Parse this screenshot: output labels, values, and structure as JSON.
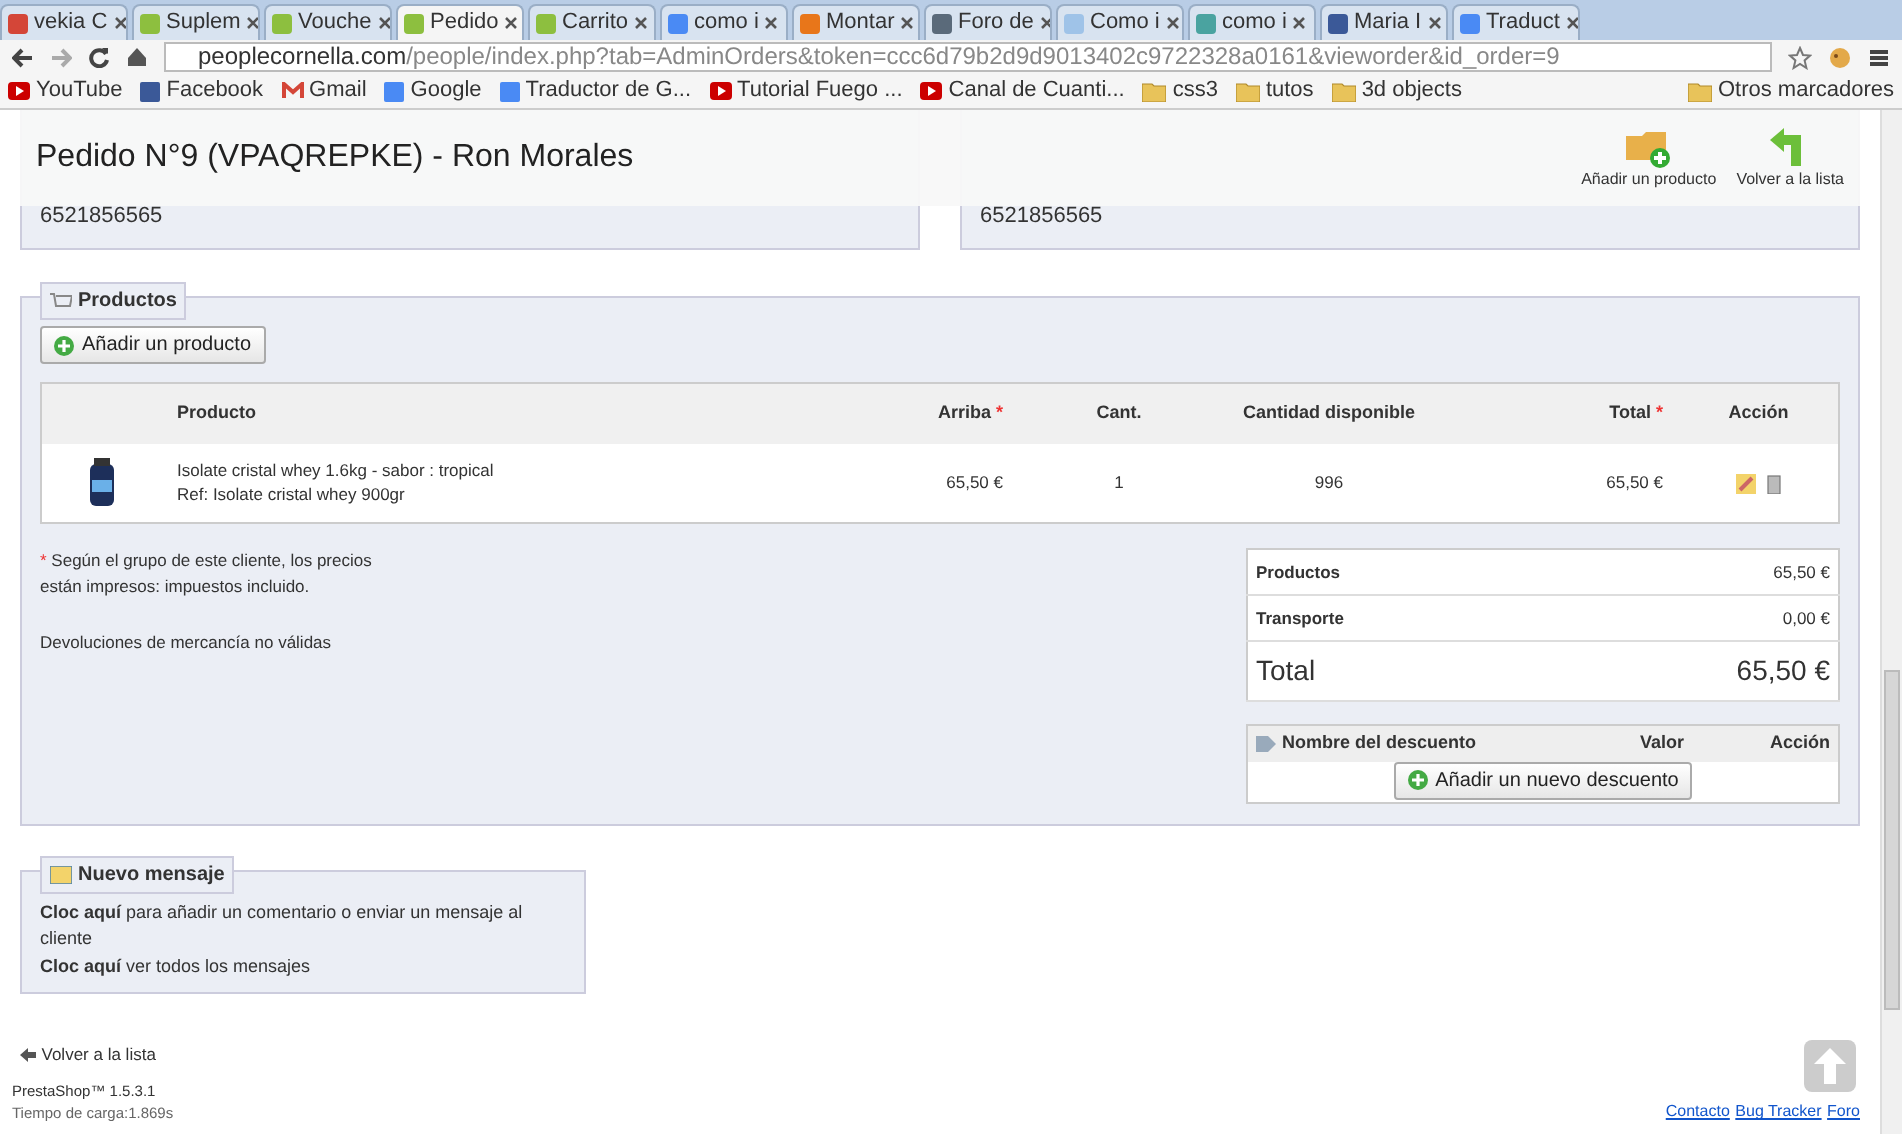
{
  "browser": {
    "tabs": [
      {
        "title": "vekia C",
        "selected": false,
        "color": "#d44638"
      },
      {
        "title": "Suplem",
        "selected": false,
        "color": "#8dbf3f"
      },
      {
        "title": "Vouche",
        "selected": false,
        "color": "#8dbf3f"
      },
      {
        "title": "Pedido",
        "selected": true,
        "color": "#8dbf3f"
      },
      {
        "title": "Carrito",
        "selected": false,
        "color": "#8dbf3f"
      },
      {
        "title": "como i",
        "selected": false,
        "color": "#4a8af4"
      },
      {
        "title": "Montar",
        "selected": false,
        "color": "#e8761a"
      },
      {
        "title": "Foro de",
        "selected": false,
        "color": "#5a6a7a"
      },
      {
        "title": "Como i",
        "selected": false,
        "color": "#9fc3e8"
      },
      {
        "title": "como i",
        "selected": false,
        "color": "#4aa3a0"
      },
      {
        "title": "Maria I",
        "selected": false,
        "color": "#3b5998"
      },
      {
        "title": "Traduct",
        "selected": false,
        "color": "#4a8af4"
      }
    ],
    "url_host": "peoplecornella.com",
    "url_path": "/people/index.php?tab=AdminOrders&token=ccc6d79b2d9d9013402c9722328a0161&vieworder&id_order=9",
    "bookmarks": [
      {
        "label": "YouTube",
        "kind": "video",
        "color": "#cc0000"
      },
      {
        "label": "Facebook",
        "kind": "square",
        "color": "#3b5998"
      },
      {
        "label": "Gmail",
        "kind": "mail",
        "color": "#d44638"
      },
      {
        "label": "Google",
        "kind": "square",
        "color": "#4a8af4"
      },
      {
        "label": "Traductor de G...",
        "kind": "square",
        "color": "#4a8af4"
      },
      {
        "label": "Tutorial Fuego ...",
        "kind": "video",
        "color": "#cc0000"
      },
      {
        "label": "Canal de Cuanti...",
        "kind": "video",
        "color": "#cc0000"
      },
      {
        "label": "css3",
        "kind": "folder",
        "color": "#e8c35a"
      },
      {
        "label": "tutos",
        "kind": "folder",
        "color": "#e8c35a"
      },
      {
        "label": "3d objects",
        "kind": "folder",
        "color": "#e8c35a"
      }
    ],
    "other_bookmarks": "Otros marcadores"
  },
  "header": {
    "title": "Pedido N°9 (VPAQREPKE) - Ron Morales",
    "actions": [
      "Añadir un producto",
      "Volver a la lista"
    ]
  },
  "addresses": [
    {
      "phone": "6521856565"
    },
    {
      "phone": "6521856565"
    }
  ],
  "products": {
    "legend": "Productos",
    "add_button": "Añadir un producto",
    "columns": [
      {
        "label": "Producto",
        "required": false
      },
      {
        "label": "Arriba",
        "required": true
      },
      {
        "label": "Cant.",
        "required": false
      },
      {
        "label": "Cantidad disponible",
        "required": false
      },
      {
        "label": "Total",
        "required": true
      },
      {
        "label": "Acción",
        "required": false
      }
    ],
    "rows": [
      {
        "name": "Isolate cristal whey 1.6kg - sabor : tropical",
        "ref": "Ref: Isolate cristal whey 900gr",
        "price": "65,50 €",
        "qty": "1",
        "stock": "996",
        "total": "65,50 €"
      }
    ],
    "note_mark": "*",
    "note": "Según el grupo de este cliente, los precios están impresos: impuestos incluido.",
    "returns": "Devoluciones de mercancía no válidas",
    "totals": [
      {
        "label": "Productos",
        "value": "65,50 €",
        "kind": "line"
      },
      {
        "label": "Transporte",
        "value": "0,00 €",
        "kind": "line"
      },
      {
        "label": "Total",
        "value": "65,50 €",
        "kind": "grand"
      }
    ],
    "discounts": {
      "columns": [
        "Nombre del descuento",
        "Valor",
        "Acción"
      ],
      "add_button": "Añadir un nuevo descuento"
    }
  },
  "message": {
    "legend": "Nuevo mensaje",
    "lines": [
      "**Cloc aquí** para añadir un comentario o enviar un mensaje al cliente",
      "**Cloc aquí** ver todos los mensajes"
    ]
  },
  "footer": {
    "back": "Volver a la lista",
    "version": "PrestaShop™ 1.5.3.1",
    "load_time": "Tiempo de carga:1.869s",
    "links": [
      "Contacto",
      "Bug Tracker",
      "Foro"
    ]
  }
}
